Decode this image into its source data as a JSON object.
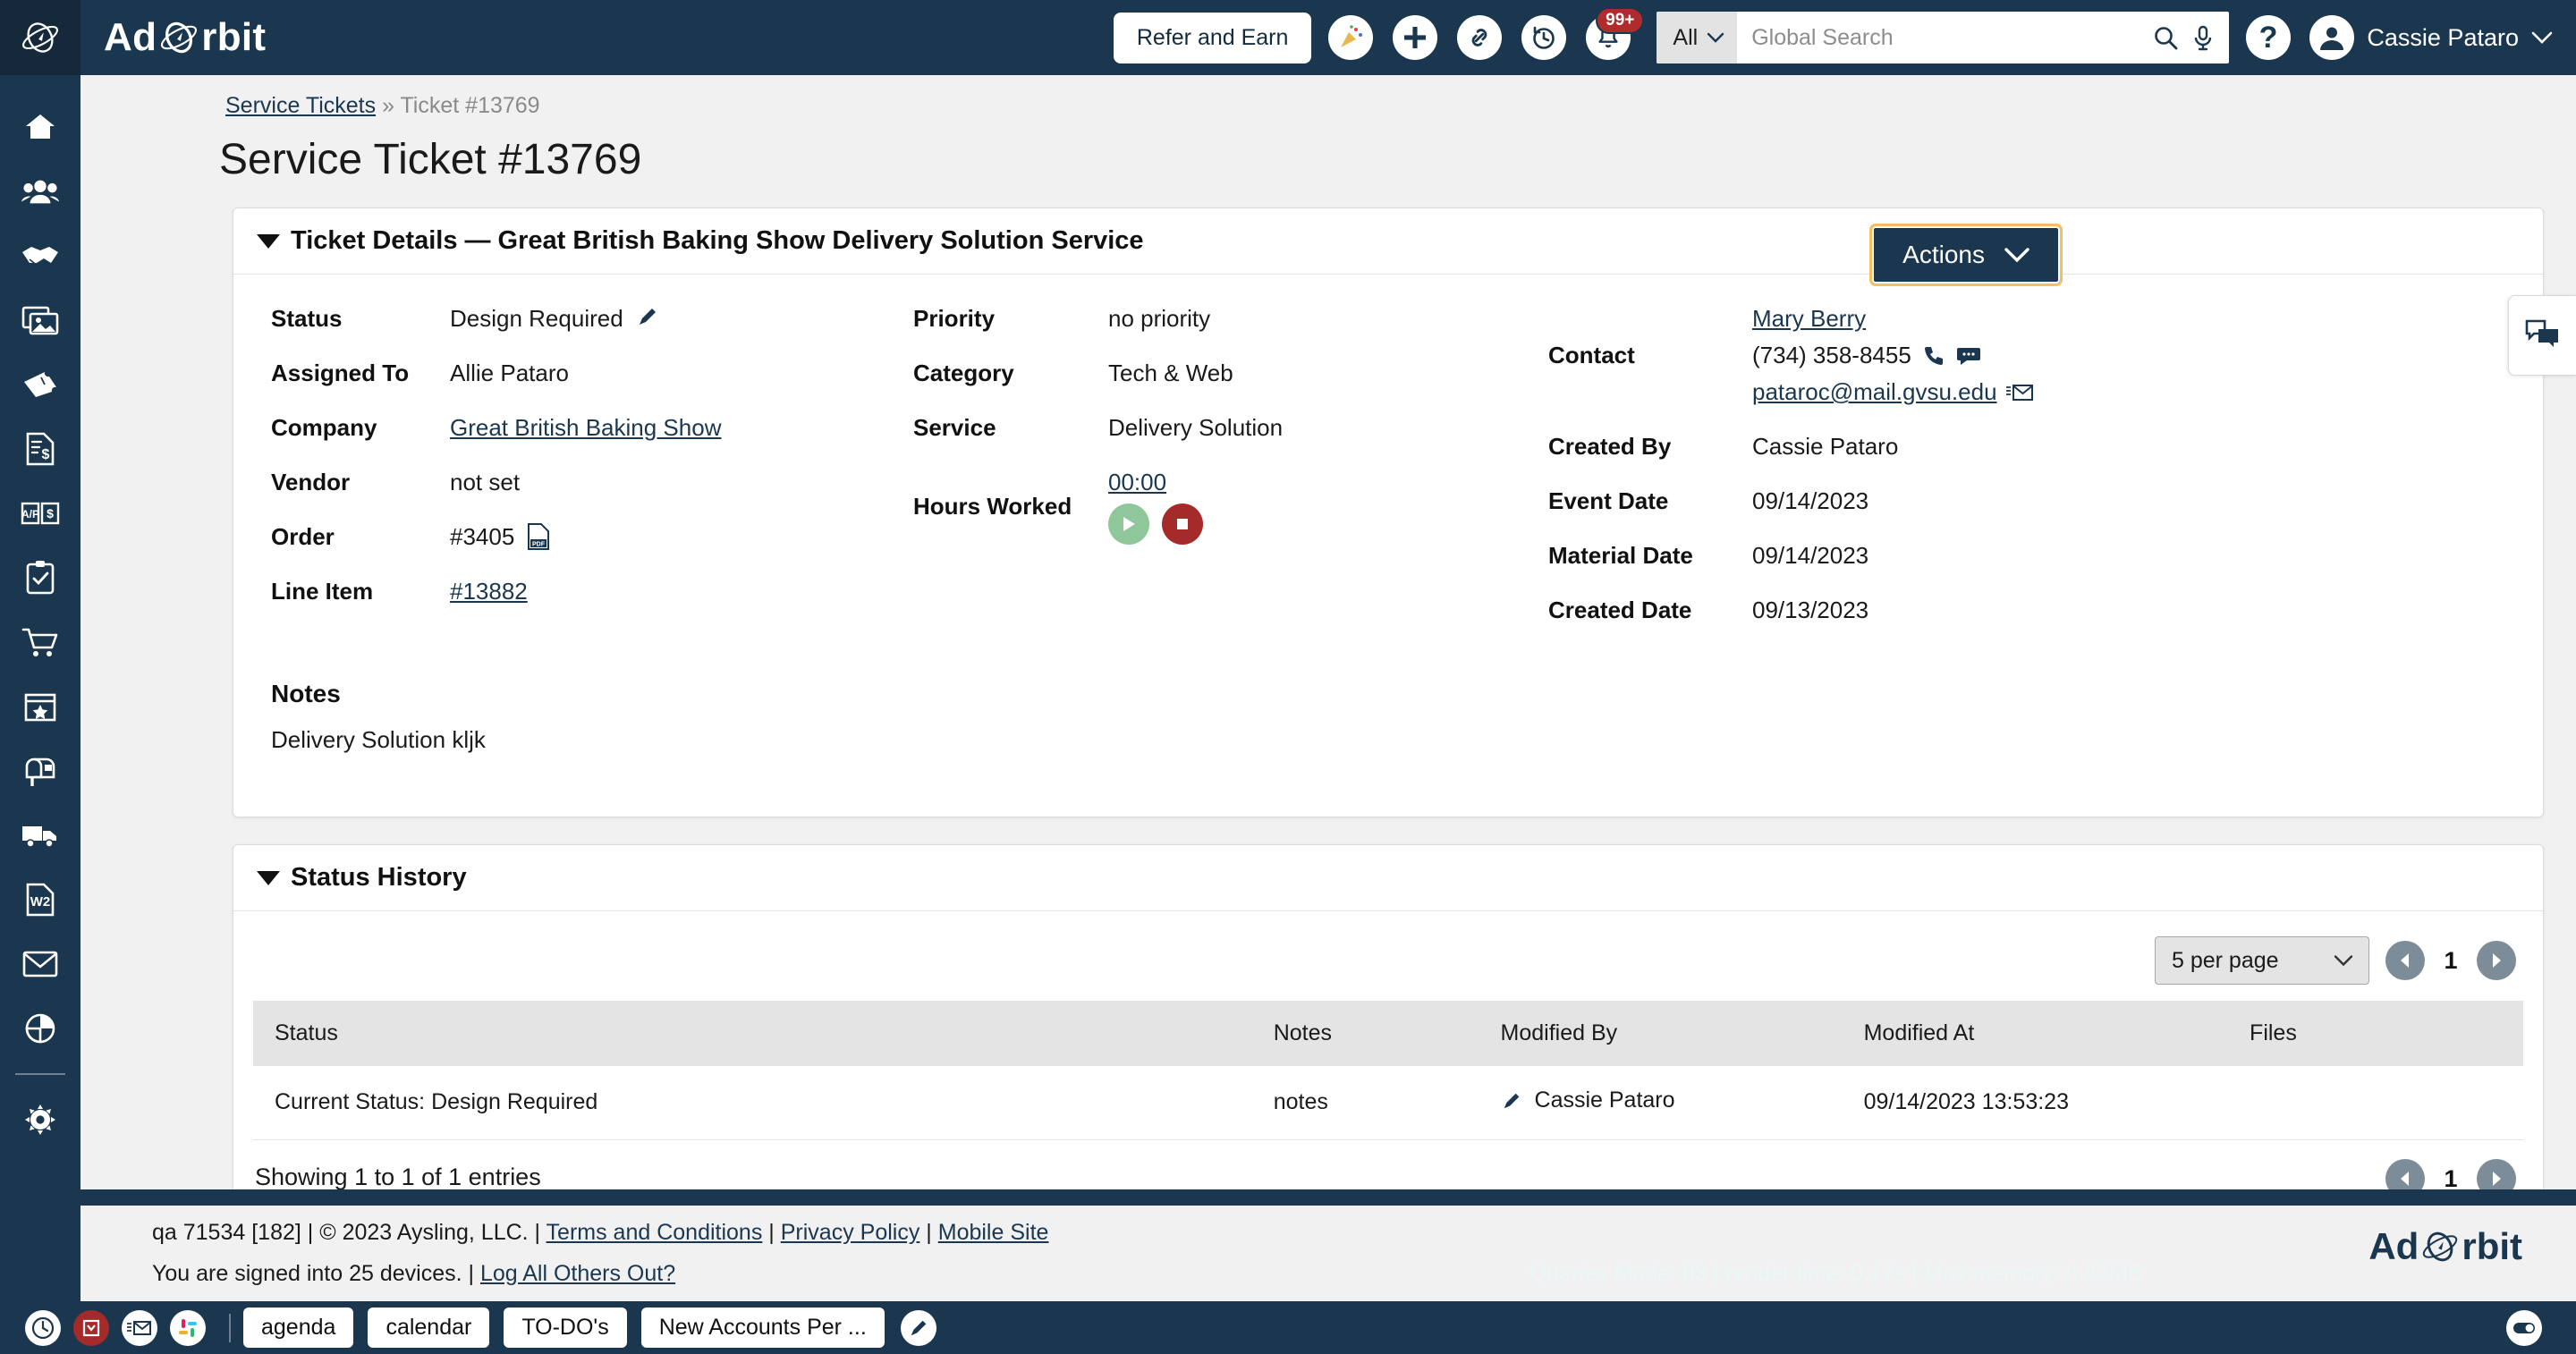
{
  "header": {
    "brand": "Ad Orbit",
    "refer_label": "Refer and Earn",
    "icons": [
      "party-popper-icon",
      "plus-icon",
      "link-icon",
      "history-clock-icon",
      "bell-icon"
    ],
    "notification_badge": "99+",
    "search_scope": "All",
    "search_placeholder": "Global Search",
    "search_value": "",
    "help_label": "?",
    "user_name": "Cassie Pataro"
  },
  "sidebar": {
    "items": [
      {
        "name": "home-icon",
        "label": "Home"
      },
      {
        "name": "users-icon",
        "label": "Contacts"
      },
      {
        "name": "handshake-icon",
        "label": "Sales"
      },
      {
        "name": "images-icon",
        "label": "Media"
      },
      {
        "name": "ticket-icon",
        "label": "Tickets"
      },
      {
        "name": "invoice-dollar-icon",
        "label": "Billing"
      },
      {
        "name": "ap-ar-book-icon",
        "label": "Accounting"
      },
      {
        "name": "clipboard-check-icon",
        "label": "Tasks"
      },
      {
        "name": "shopping-cart-icon",
        "label": "Orders"
      },
      {
        "name": "calendar-star-icon",
        "label": "Events"
      },
      {
        "name": "mailbox-icon",
        "label": "Mailbox"
      },
      {
        "name": "truck-icon",
        "label": "Distribution"
      },
      {
        "name": "w2-document-icon",
        "label": "Payroll"
      },
      {
        "name": "envelope-icon",
        "label": "Email"
      },
      {
        "name": "pie-chart-icon",
        "label": "Reports"
      },
      {
        "name": "gear-icon",
        "label": "Settings"
      }
    ]
  },
  "breadcrumb": {
    "link": "Service Tickets",
    "separator": "»",
    "current": "Ticket #13769"
  },
  "page": {
    "title": "Service Ticket #13769",
    "actions_label": "Actions"
  },
  "ticket_details": {
    "panel_title": "Ticket Details — Great British Baking Show Delivery Solution Service",
    "left": [
      {
        "label": "Status",
        "value": "Design Required",
        "edit_icon": "pencil-icon"
      },
      {
        "label": "Assigned To",
        "value": "Allie Pataro"
      },
      {
        "label": "Company",
        "value": "Great British Baking Show",
        "link": true
      },
      {
        "label": "Vendor",
        "value": "not set"
      },
      {
        "label": "Order",
        "value": "#3405",
        "doc_icon": "pdf-icon"
      },
      {
        "label": "Line Item",
        "value": "#13882",
        "link": true
      }
    ],
    "middle": [
      {
        "label": "Priority",
        "value": "no priority"
      },
      {
        "label": "Category",
        "value": "Tech & Web"
      },
      {
        "label": "Service",
        "value": "Delivery Solution"
      }
    ],
    "hours": {
      "label": "Hours Worked",
      "value": "00:00",
      "play_icon": "play-icon",
      "stop_icon": "stop-icon"
    },
    "right": {
      "contact_label": "Contact",
      "contact_name": "Mary Berry",
      "contact_phone": "(734) 358-8455",
      "phone_icon": "phone-icon",
      "sms_icon": "chat-bubble-icon",
      "contact_email": "pataroc@mail.gvsu.edu",
      "email_icon": "envelope-icon",
      "rows": [
        {
          "label": "Created By",
          "value": "Cassie Pataro"
        },
        {
          "label": "Event Date",
          "value": "09/14/2023"
        },
        {
          "label": "Material Date",
          "value": "09/14/2023"
        },
        {
          "label": "Created Date",
          "value": "09/13/2023"
        }
      ]
    },
    "notes_heading": "Notes",
    "notes_text": "Delivery Solution kljk"
  },
  "status_history": {
    "panel_title": "Status History",
    "per_page": "5 per page",
    "page_number": "1",
    "prev_icon": "chevron-left-circle-icon",
    "next_icon": "chevron-right-circle-icon",
    "columns": [
      "Status",
      "Notes",
      "Modified By",
      "Modified At",
      "Files"
    ],
    "rows": [
      {
        "status": "Current Status: Design Required",
        "notes": "notes",
        "edit_icon": "pencil-icon",
        "modified_by": "Cassie Pataro",
        "modified_at": "09/14/2023 13:53:23",
        "files": ""
      }
    ],
    "showing": "Showing 1 to 1 of 1 entries",
    "foot_page_number": "1"
  },
  "chat_tab": {
    "icon": "chat-bubbles-icon"
  },
  "footer": {
    "build": "qa 71534 [182] | © 2023 Aysling, LLC. |",
    "terms": "Terms and Conditions",
    "sep1": "|",
    "privacy": "Privacy Policy",
    "sep2": "|",
    "mobile": "Mobile Site",
    "devices": "You are signed into 25 devices.  |",
    "logout_all": "Log All Others Out?",
    "stats": "Queries Made: 83 | render time: 0.17s | Max memory: 8.82MB",
    "logo": "Ad Orbit"
  },
  "taskbar": {
    "icons": [
      "clock-icon",
      "inbox-red-icon",
      "mail-list-icon",
      "slack-icon"
    ],
    "buttons": [
      "agenda",
      "calendar",
      "TO-DO's",
      "New Accounts Per ..."
    ],
    "edit_icon": "pencil-circle-icon",
    "toggle_icon": "toggle-switch-icon"
  },
  "colors": {
    "navy": "#1b3750",
    "navy_dark": "#15293a",
    "accent_gold": "#f4bf63",
    "danger": "#a52a2a",
    "success": "#8fc79a",
    "page_bg": "#f1f1f1"
  }
}
